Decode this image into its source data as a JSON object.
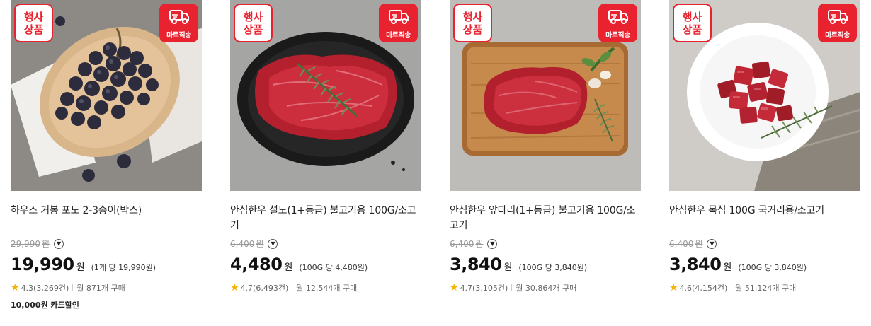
{
  "badges": {
    "event_line1": "행사",
    "event_line2": "상품",
    "mart_label": "마트직송"
  },
  "colors": {
    "accent": "#e8232f",
    "star": "#f5b400"
  },
  "products": [
    {
      "title": "하우스 거봉 포도 2-3송이(박스)",
      "original_price": "29,990",
      "won": "원",
      "dropdown": "▼",
      "price": "19,990",
      "unit_price": "(1개 당 19,990원)",
      "rating": "4.3(3,269건)",
      "monthly": "월 871개 구매",
      "extra": "10,000원 카드할인",
      "image_icon": "grapes-image"
    },
    {
      "title": "안심한우 설도(1+등급) 불고기용 100G/소고기",
      "original_price": "6,400",
      "won": "원",
      "dropdown": "▼",
      "price": "4,480",
      "unit_price": "(100G 당 4,480원)",
      "rating": "4.7(6,493건)",
      "monthly": "월 12,544개 구매",
      "extra": "",
      "image_icon": "beef-slice-image"
    },
    {
      "title": "안심한우 앞다리(1+등급) 불고기용 100G/소고기",
      "original_price": "6,400",
      "won": "원",
      "dropdown": "▼",
      "price": "3,840",
      "unit_price": "(100G 당 3,840원)",
      "rating": "4.7(3,105건)",
      "monthly": "월 30,864개 구매",
      "extra": "",
      "image_icon": "beef-board-image"
    },
    {
      "title": "안심한우 목심 100G 국거리용/소고기",
      "original_price": "6,400",
      "won": "원",
      "dropdown": "▼",
      "price": "3,840",
      "unit_price": "(100G 당 3,840원)",
      "rating": "4.6(4,154건)",
      "monthly": "월 51,124개 구매",
      "extra": "",
      "image_icon": "beef-cubes-image"
    }
  ]
}
